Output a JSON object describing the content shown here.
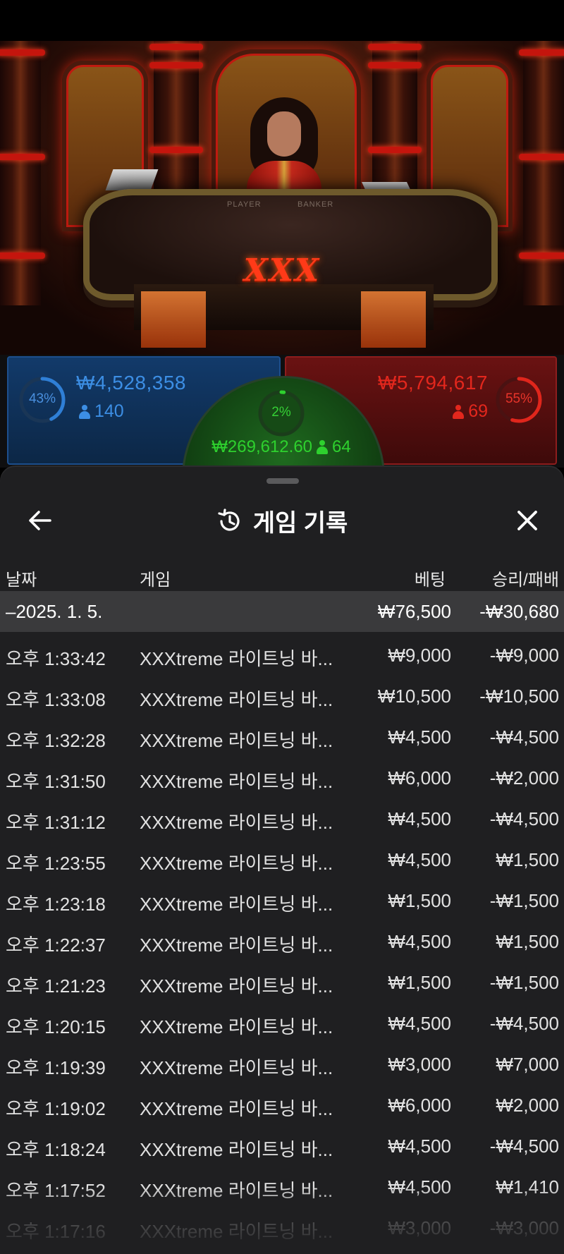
{
  "scene": {
    "logo_text": "XXX",
    "table_labels": [
      "PLAYER",
      "BANKER"
    ]
  },
  "bets": {
    "player": {
      "percent": "43%",
      "percent_value": 43,
      "amount": "₩4,528,358",
      "players": "140",
      "color": "#2f7fd6"
    },
    "banker": {
      "percent": "55%",
      "percent_value": 55,
      "amount": "₩5,794,617",
      "players": "69",
      "color": "#e0261c"
    },
    "tie": {
      "percent": "2%",
      "percent_value": 2,
      "amount": "₩269,612.60",
      "players": "64",
      "color": "#2ed12e"
    }
  },
  "sheet": {
    "title": "게임 기록",
    "icons": {
      "back": "arrow-left-icon",
      "history": "history-icon",
      "close": "close-icon"
    },
    "columns": {
      "date": "날짜",
      "game": "게임",
      "bet": "베팅",
      "result": "승리/패배"
    },
    "date_group": {
      "label": "–2025. 1. 5.",
      "bet": "₩76,500",
      "result": "-₩30,680"
    },
    "rows": [
      {
        "time": "오후 1:33:42",
        "game": "XXXtreme 라이트닝 바...",
        "bet": "₩9,000",
        "result": "-₩9,000"
      },
      {
        "time": "오후 1:33:08",
        "game": "XXXtreme 라이트닝 바...",
        "bet": "₩10,500",
        "result": "-₩10,500"
      },
      {
        "time": "오후 1:32:28",
        "game": "XXXtreme 라이트닝 바...",
        "bet": "₩4,500",
        "result": "-₩4,500"
      },
      {
        "time": "오후 1:31:50",
        "game": "XXXtreme 라이트닝 바...",
        "bet": "₩6,000",
        "result": "-₩2,000"
      },
      {
        "time": "오후 1:31:12",
        "game": "XXXtreme 라이트닝 바...",
        "bet": "₩4,500",
        "result": "-₩4,500"
      },
      {
        "time": "오후 1:23:55",
        "game": "XXXtreme 라이트닝 바...",
        "bet": "₩4,500",
        "result": "₩1,500"
      },
      {
        "time": "오후 1:23:18",
        "game": "XXXtreme 라이트닝 바...",
        "bet": "₩1,500",
        "result": "-₩1,500"
      },
      {
        "time": "오후 1:22:37",
        "game": "XXXtreme 라이트닝 바...",
        "bet": "₩4,500",
        "result": "₩1,500"
      },
      {
        "time": "오후 1:21:23",
        "game": "XXXtreme 라이트닝 바...",
        "bet": "₩1,500",
        "result": "-₩1,500"
      },
      {
        "time": "오후 1:20:15",
        "game": "XXXtreme 라이트닝 바...",
        "bet": "₩4,500",
        "result": "-₩4,500"
      },
      {
        "time": "오후 1:19:39",
        "game": "XXXtreme 라이트닝 바...",
        "bet": "₩3,000",
        "result": "₩7,000"
      },
      {
        "time": "오후 1:19:02",
        "game": "XXXtreme 라이트닝 바...",
        "bet": "₩6,000",
        "result": "₩2,000"
      },
      {
        "time": "오후 1:18:24",
        "game": "XXXtreme 라이트닝 바...",
        "bet": "₩4,500",
        "result": "-₩4,500"
      },
      {
        "time": "오후 1:17:52",
        "game": "XXXtreme 라이트닝 바...",
        "bet": "₩4,500",
        "result": "₩1,410"
      },
      {
        "time": "오후 1:17:16",
        "game": "XXXtreme 라이트닝 바...",
        "bet": "₩3,000",
        "result": "-₩3,000"
      }
    ]
  }
}
